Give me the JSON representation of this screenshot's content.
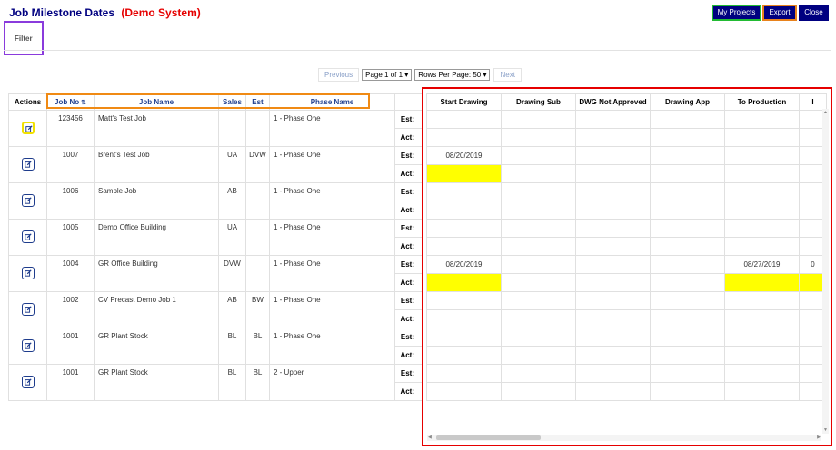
{
  "page": {
    "title": "Job Milestone Dates",
    "subtitle": "(Demo System)"
  },
  "toolbar": {
    "my_projects": "My Projects",
    "export": "Export",
    "close": "Close"
  },
  "filter": {
    "label": "Filter"
  },
  "pager": {
    "previous": "Previous",
    "page_select": "Page 1 of 1",
    "rows_select": "Rows Per Page: 50",
    "next": "Next"
  },
  "left_table": {
    "headers": {
      "actions": "Actions",
      "job_no": "Job No",
      "job_name": "Job Name",
      "sales": "Sales",
      "est": "Est",
      "phase_name": "Phase Name"
    },
    "est_label": "Est:",
    "act_label": "Act:",
    "rows": [
      {
        "job_no": "123456",
        "job_name": "Matt's Test Job",
        "sales": "",
        "est": "",
        "phase": "1 - Phase One"
      },
      {
        "job_no": "1007",
        "job_name": "Brent's Test Job",
        "sales": "UA",
        "est": "DVW",
        "phase": "1 - Phase One"
      },
      {
        "job_no": "1006",
        "job_name": "Sample Job",
        "sales": "AB",
        "est": "",
        "phase": "1 - Phase One"
      },
      {
        "job_no": "1005",
        "job_name": "Demo Office Building",
        "sales": "UA",
        "est": "",
        "phase": "1 - Phase One"
      },
      {
        "job_no": "1004",
        "job_name": "GR Office Building",
        "sales": "DVW",
        "est": "",
        "phase": "1 - Phase One"
      },
      {
        "job_no": "1002",
        "job_name": "CV Precast Demo Job 1",
        "sales": "AB",
        "est": "BW",
        "phase": "1 - Phase One"
      },
      {
        "job_no": "1001",
        "job_name": "GR Plant Stock",
        "sales": "BL",
        "est": "BL",
        "phase": "1 - Phase One"
      },
      {
        "job_no": "1001",
        "job_name": "GR Plant Stock",
        "sales": "BL",
        "est": "BL",
        "phase": "2 - Upper"
      }
    ]
  },
  "milestone_grid": {
    "columns": [
      "Start Drawing",
      "Drawing Sub",
      "DWG Not Approved",
      "Drawing App",
      "To Production",
      "I"
    ],
    "highlight_color": "#ffff00",
    "rows": [
      {
        "est": [
          "",
          "",
          "",
          "",
          "",
          ""
        ],
        "act": [
          "",
          "",
          "",
          "",
          "",
          ""
        ],
        "act_highlight": []
      },
      {
        "est": [
          "08/20/2019",
          "",
          "",
          "",
          "",
          ""
        ],
        "act": [
          "",
          "",
          "",
          "",
          "",
          ""
        ],
        "act_highlight": [
          0
        ]
      },
      {
        "est": [
          "",
          "",
          "",
          "",
          "",
          ""
        ],
        "act": [
          "",
          "",
          "",
          "",
          "",
          ""
        ],
        "act_highlight": []
      },
      {
        "est": [
          "",
          "",
          "",
          "",
          "",
          ""
        ],
        "act": [
          "",
          "",
          "",
          "",
          "",
          ""
        ],
        "act_highlight": []
      },
      {
        "est": [
          "08/20/2019",
          "",
          "",
          "",
          "08/27/2019",
          "0"
        ],
        "act": [
          "",
          "",
          "",
          "",
          "",
          ""
        ],
        "act_highlight": [
          0,
          4,
          5
        ]
      },
      {
        "est": [
          "",
          "",
          "",
          "",
          "",
          ""
        ],
        "act": [
          "",
          "",
          "",
          "",
          "",
          ""
        ],
        "act_highlight": []
      },
      {
        "est": [
          "",
          "",
          "",
          "",
          "",
          ""
        ],
        "act": [
          "",
          "",
          "",
          "",
          "",
          ""
        ],
        "act_highlight": []
      },
      {
        "est": [
          "",
          "",
          "",
          "",
          "",
          ""
        ],
        "act": [
          "",
          "",
          "",
          "",
          "",
          ""
        ],
        "act_highlight": []
      }
    ]
  }
}
